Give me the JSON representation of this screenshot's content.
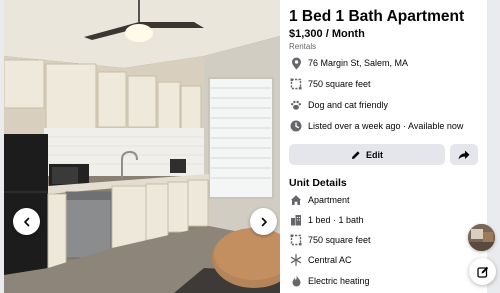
{
  "listing": {
    "title": "1 Bed 1 Bath Apartment",
    "price": "$1,300 / Month",
    "category": "Rentals"
  },
  "details": [
    {
      "icon": "location-pin-icon",
      "text": "76 Margin St, Salem, MA"
    },
    {
      "icon": "square-footage-icon",
      "text": "750 square feet"
    },
    {
      "icon": "paw-icon",
      "text": "Dog and cat friendly"
    },
    {
      "icon": "clock-icon",
      "text": "Listed over a week ago · Available now"
    }
  ],
  "actions": {
    "edit_label": "Edit",
    "share_icon": "share-arrow-icon"
  },
  "unit_details": {
    "heading": "Unit Details",
    "items": [
      {
        "icon": "house-icon",
        "text": "Apartment"
      },
      {
        "icon": "building-icon",
        "text": "1 bed · 1 bath"
      },
      {
        "icon": "square-footage-icon",
        "text": "750 square feet"
      },
      {
        "icon": "snowflake-icon",
        "text": "Central AC"
      },
      {
        "icon": "flame-icon",
        "text": "Electric heating"
      }
    ]
  },
  "photo": {
    "subject": "kitchen-photo",
    "prev_icon": "chevron-left-icon",
    "next_icon": "chevron-right-icon"
  },
  "floating": {
    "avatar": "chat-avatar",
    "compose_icon": "compose-icon"
  },
  "colors": {
    "page_background": "#e9ebee",
    "panel_background": "#ffffff",
    "button_gray": "#e4e6eb",
    "secondary_text": "#65676b"
  }
}
